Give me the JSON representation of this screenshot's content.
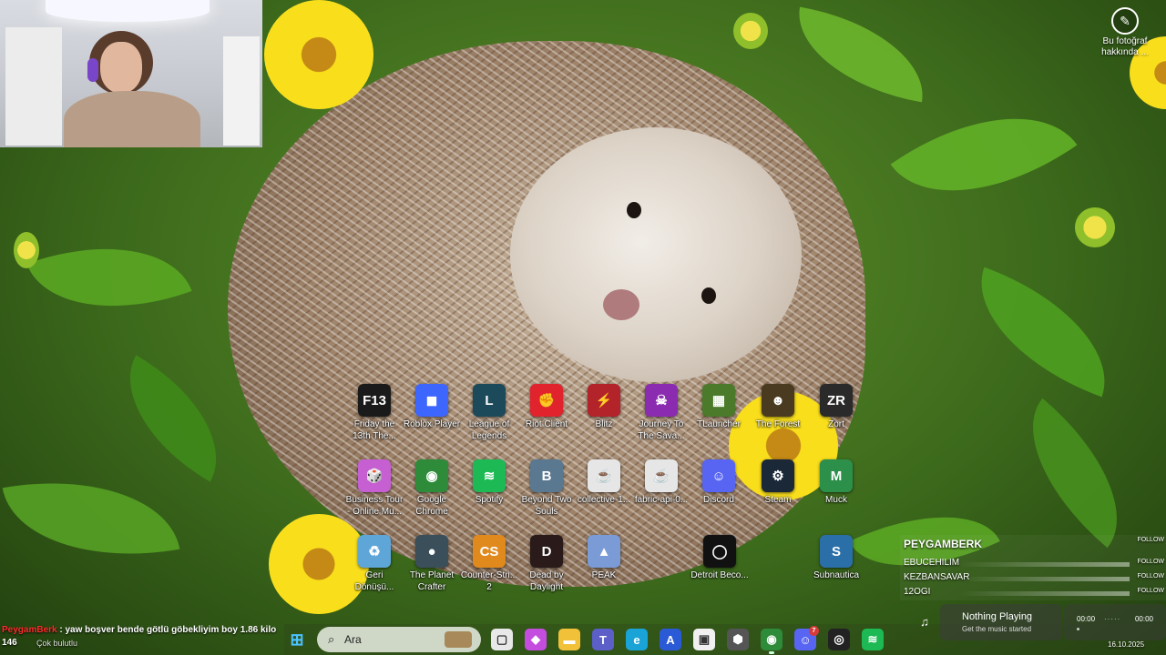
{
  "about_photo": {
    "label": "Bu fotoğraf hakkında ..."
  },
  "desktop": {
    "icons": [
      {
        "label": "Friday the 13th The...",
        "glyph": "F13",
        "color": "#1a1a1a"
      },
      {
        "label": "Roblox Player",
        "glyph": "◼",
        "color": "#3d66ff"
      },
      {
        "label": "League of Legends",
        "glyph": "L",
        "color": "#1c4a5a"
      },
      {
        "label": "Riot Client",
        "glyph": "✊",
        "color": "#e0232d"
      },
      {
        "label": "Blitz",
        "glyph": "⚡",
        "color": "#b3232a"
      },
      {
        "label": "Journey To The Sava...",
        "glyph": "☠",
        "color": "#8a2bb0"
      },
      {
        "label": "TLauncher",
        "glyph": "▦",
        "color": "#4a7a2a"
      },
      {
        "label": "The Forest",
        "glyph": "☻",
        "color": "#4a3a20"
      },
      {
        "label": "Zort",
        "glyph": "ZR",
        "color": "#2a2a2a"
      },
      {
        "label": "Business Tour - Online Mu...",
        "glyph": "🎲",
        "color": "#c65fd1"
      },
      {
        "label": "Google Chrome",
        "glyph": "◉",
        "color": "#2e8b3a"
      },
      {
        "label": "Spotify",
        "glyph": "≋",
        "color": "#1db954"
      },
      {
        "label": "Beyond Two Souls",
        "glyph": "B",
        "color": "#5a7890"
      },
      {
        "label": "collective-1...",
        "glyph": "☕",
        "color": "#e6e6e6"
      },
      {
        "label": "fabric-api-0...",
        "glyph": "☕",
        "color": "#e6e6e6"
      },
      {
        "label": "Discord",
        "glyph": "☺",
        "color": "#5865f2"
      },
      {
        "label": "Steam",
        "glyph": "⚙",
        "color": "#1b2838"
      },
      {
        "label": "Muck",
        "glyph": "M",
        "color": "#2c8f4a"
      },
      {
        "label": "Geri Dönüşü...",
        "glyph": "♻",
        "color": "#5fa6d8"
      },
      {
        "label": "The Planet Crafter",
        "glyph": "●",
        "color": "#3a4f5a"
      },
      {
        "label": "Counter-Stri... 2",
        "glyph": "CS",
        "color": "#e08a1e"
      },
      {
        "label": "Dead by Daylight",
        "glyph": "D",
        "color": "#2a1a1a"
      },
      {
        "label": "PEAK",
        "glyph": "▲",
        "color": "#7a9bd6"
      },
      {
        "label": "Detroit Beco...",
        "glyph": "◯",
        "color": "#111111"
      },
      {
        "label": "Subnautica",
        "glyph": "S",
        "color": "#2a6fa8"
      }
    ]
  },
  "follow_overlay": {
    "title": "PEYGAMBERK",
    "title_follow": "FOLLOW",
    "rows": [
      {
        "name": "EBUCEHILIM",
        "follow": "FOLLOW"
      },
      {
        "name": "KEZBANSAVAR",
        "follow": "FOLLOW"
      },
      {
        "name": "12OGI",
        "follow": "FOLLOW"
      }
    ]
  },
  "chat": {
    "username": "PeygamBerk",
    "message": " : yaw boşver bende götlü göbekliyim boy 1.86 kilo 146",
    "sub": "Çok bulutlu"
  },
  "taskbar": {
    "search_placeholder": "Ara",
    "apps": [
      {
        "name": "task-view",
        "glyph": "▢",
        "color": "#e8e8e8"
      },
      {
        "name": "copilot",
        "glyph": "◆",
        "color": "#c44de0"
      },
      {
        "name": "file-explorer",
        "glyph": "▬",
        "color": "#f2c13a"
      },
      {
        "name": "teams",
        "glyph": "T",
        "color": "#5b5fc7"
      },
      {
        "name": "edge",
        "glyph": "e",
        "color": "#1aa3d6"
      },
      {
        "name": "app-blue",
        "glyph": "A",
        "color": "#2a5ad6"
      },
      {
        "name": "store",
        "glyph": "▣",
        "color": "#f0f0f0"
      },
      {
        "name": "app-dark",
        "glyph": "⬢",
        "color": "#555555"
      },
      {
        "name": "chrome",
        "glyph": "◉",
        "color": "#2e8b3a"
      },
      {
        "name": "discord",
        "glyph": "☺",
        "color": "#5865f2",
        "badge": "7"
      },
      {
        "name": "obs",
        "glyph": "◎",
        "color": "#222222"
      },
      {
        "name": "spotify",
        "glyph": "≋",
        "color": "#1db954"
      }
    ]
  },
  "now_playing": {
    "title": "Nothing Playing",
    "subtitle": "Get the music started",
    "time_start": "00:00",
    "time_end": "00:00",
    "dots": "·····"
  },
  "clock": {
    "date": "16.10.2025"
  }
}
